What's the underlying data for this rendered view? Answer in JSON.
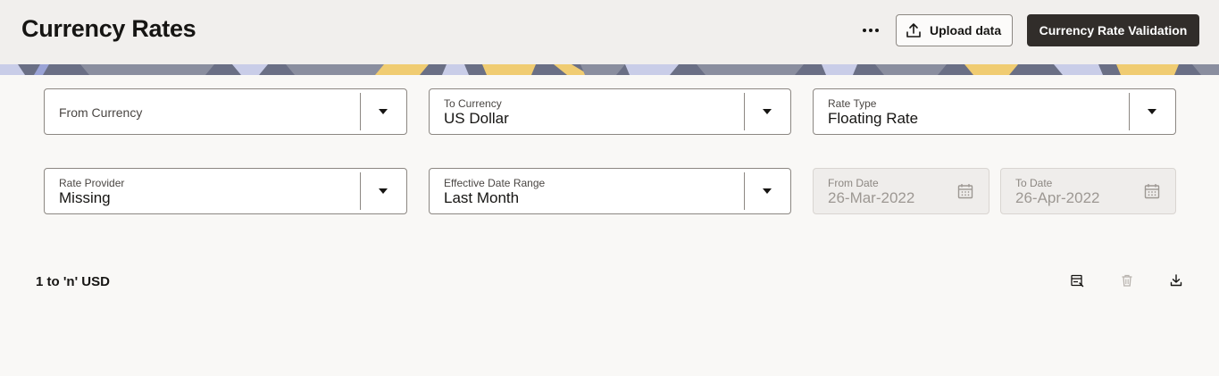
{
  "header": {
    "title": "Currency Rates",
    "more_icon": "ellipsis-icon",
    "upload_label": "Upload data",
    "upload_icon": "upload-icon",
    "validate_label": "Currency Rate Validation"
  },
  "filters": {
    "from_currency": {
      "label": "From Currency",
      "value": ""
    },
    "to_currency": {
      "label": "To Currency",
      "value": "US Dollar"
    },
    "rate_type": {
      "label": "Rate Type",
      "value": "Floating Rate"
    },
    "rate_provider": {
      "label": "Rate Provider",
      "value": "Missing"
    },
    "date_range": {
      "label": "Effective Date Range",
      "value": "Last Month"
    },
    "from_date": {
      "label": "From Date",
      "value": "26-Mar-2022"
    },
    "to_date": {
      "label": "To Date",
      "value": "26-Apr-2022"
    }
  },
  "results": {
    "count_label": "1 to 'n' USD",
    "icons": [
      "edit-rows-icon",
      "delete-icon",
      "download-icon"
    ]
  },
  "colors": {
    "header_bg": "#f1efed",
    "primary_button": "#312d2a",
    "page_bg": "#f9f8f6",
    "banner_yellow": "#f0cc72",
    "banner_slate": "#6a6f85"
  }
}
